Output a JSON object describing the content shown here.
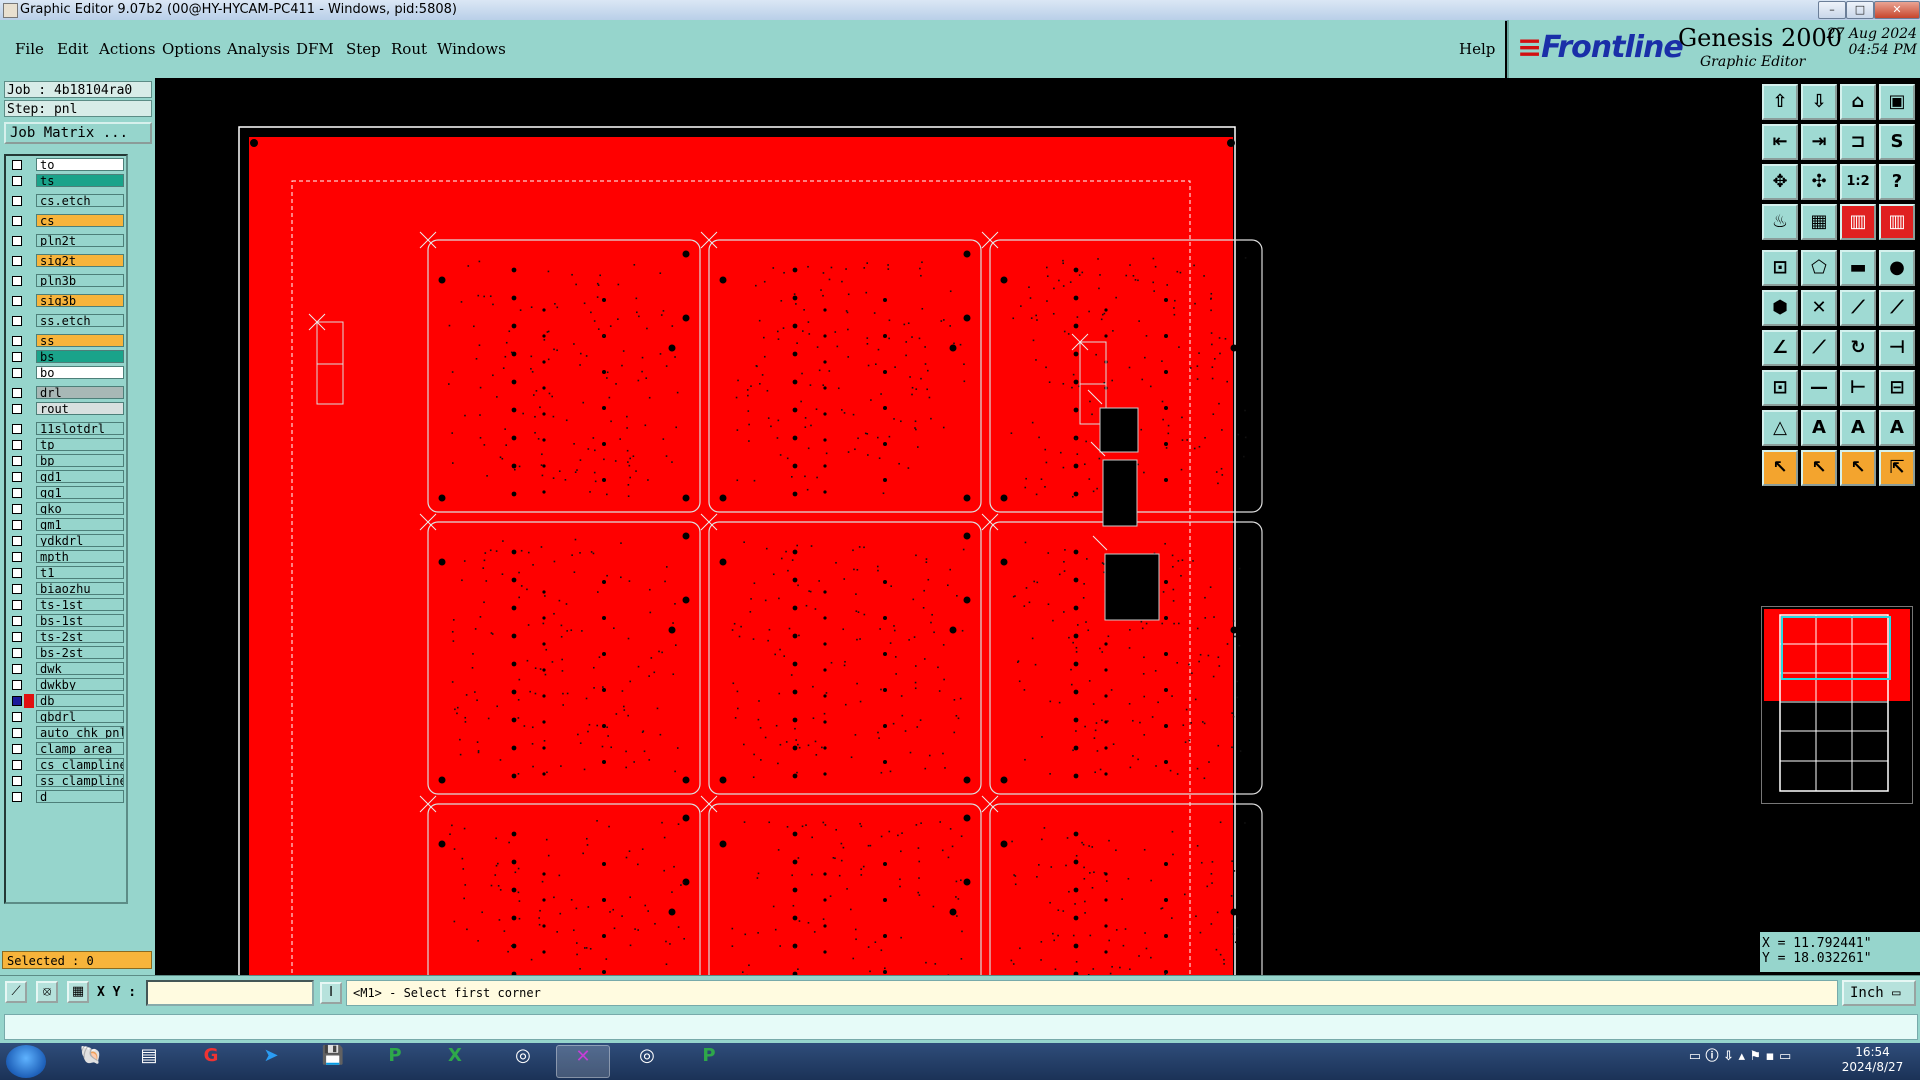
{
  "window": {
    "title": "Graphic Editor 9.07b2 (00@HY-HYCAM-PC411 - Windows, pid:5808)",
    "buttons": [
      "–",
      "□",
      "✕"
    ]
  },
  "menu": {
    "items": [
      "File",
      "Edit",
      "Actions",
      "Options",
      "Analysis",
      "DFM",
      "Step",
      "Rout",
      "Windows"
    ],
    "help": "Help"
  },
  "brand": {
    "logo": "Frontline",
    "product": "Genesis 2000",
    "subtitle": "Graphic Editor",
    "date": "27 Aug 2024",
    "time": "04:54 PM"
  },
  "job": {
    "job_line": "Job : 4b18104ra0",
    "step_line": "Step: pnl",
    "matrix_button": "Job Matrix ..."
  },
  "layers": [
    {
      "name": "to",
      "color": "#ffffff",
      "gap": false
    },
    {
      "name": "ts",
      "color": "#1aa38a",
      "gap": false
    },
    {
      "name": "cs.etch",
      "color": "#96d5cc",
      "gap": true
    },
    {
      "name": "cs",
      "color": "#f7b43b",
      "gap": true
    },
    {
      "name": "pln2t",
      "color": "#96d5cc",
      "gap": true
    },
    {
      "name": "sig2t",
      "color": "#f7b43b",
      "gap": true
    },
    {
      "name": "pln3b",
      "color": "#96d5cc",
      "gap": true
    },
    {
      "name": "sig3b",
      "color": "#f7b43b",
      "gap": true
    },
    {
      "name": "ss.etch",
      "color": "#96d5cc",
      "gap": true
    },
    {
      "name": "ss",
      "color": "#f7b43b",
      "gap": true
    },
    {
      "name": "bs",
      "color": "#1aa38a",
      "gap": false
    },
    {
      "name": "bo",
      "color": "#ffffff",
      "gap": false
    },
    {
      "name": "drl",
      "color": "#a8b8b6",
      "gap": true
    },
    {
      "name": "rout",
      "color": "#d8e0df",
      "gap": false
    },
    {
      "name": "11slotdrl",
      "color": "#96d5cc",
      "gap": true
    },
    {
      "name": "tp",
      "color": "#96d5cc",
      "gap": false
    },
    {
      "name": "bp",
      "color": "#96d5cc",
      "gap": false
    },
    {
      "name": "gd1",
      "color": "#96d5cc",
      "gap": false
    },
    {
      "name": "gg1",
      "color": "#96d5cc",
      "gap": false
    },
    {
      "name": "gko",
      "color": "#96d5cc",
      "gap": false
    },
    {
      "name": "gm1",
      "color": "#96d5cc",
      "gap": false
    },
    {
      "name": "ydkdrl",
      "color": "#96d5cc",
      "gap": false
    },
    {
      "name": "mpth",
      "color": "#96d5cc",
      "gap": false
    },
    {
      "name": "t1",
      "color": "#96d5cc",
      "gap": false
    },
    {
      "name": "biaozhu",
      "color": "#96d5cc",
      "gap": false
    },
    {
      "name": "ts-1st",
      "color": "#96d5cc",
      "gap": false
    },
    {
      "name": "bs-1st",
      "color": "#96d5cc",
      "gap": false
    },
    {
      "name": "ts-2st",
      "color": "#96d5cc",
      "gap": false
    },
    {
      "name": "bs-2st",
      "color": "#96d5cc",
      "gap": false
    },
    {
      "name": "dwk",
      "color": "#96d5cc",
      "gap": false
    },
    {
      "name": "dwkby",
      "color": "#96d5cc",
      "gap": false
    },
    {
      "name": "db",
      "color": "#96d5cc",
      "gap": false,
      "active": true
    },
    {
      "name": "gbdrl",
      "color": "#96d5cc",
      "gap": false
    },
    {
      "name": "auto_chk_pnl",
      "color": "#96d5cc",
      "gap": false
    },
    {
      "name": "clamp_area",
      "color": "#96d5cc",
      "gap": false
    },
    {
      "name": "cs_clampline",
      "color": "#96d5cc",
      "gap": false
    },
    {
      "name": "ss_clampline",
      "color": "#96d5cc",
      "gap": false
    },
    {
      "name": "d",
      "color": "#96d5cc",
      "gap": false
    }
  ],
  "selected": "Selected : 0",
  "coords": {
    "x": "X = 11.792441\"",
    "y": "Y = 18.032261\""
  },
  "command": {
    "xy_label": "X Y :",
    "xy_value": "",
    "prompt": "<M1> - Select first corner",
    "unit": "Inch"
  },
  "taskbar": {
    "time": "16:54",
    "date": "2024/8/27"
  },
  "colors": {
    "panel": "#96d5cc",
    "board": "#ff0000",
    "accent": "#f7b43b"
  }
}
